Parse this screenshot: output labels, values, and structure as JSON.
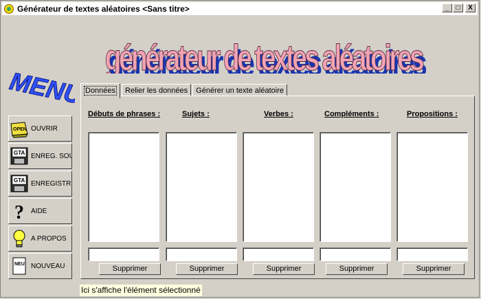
{
  "window": {
    "title": "Générateur de textes aléatoires  <Sans titre>",
    "controls": {
      "minimize": "_",
      "maximize": "□",
      "close": "X"
    }
  },
  "banner": {
    "text": "générateur de textes aléatoires"
  },
  "menu_logo": {
    "text": "MENU"
  },
  "sidebar": {
    "items": [
      {
        "label": "OUVRIR",
        "icon": "open-folder-icon",
        "icon_text": "OPEN"
      },
      {
        "label": "ENREG. SOUS",
        "icon": "save-as-disk-icon",
        "icon_text": "GTA"
      },
      {
        "label": "ENREGISTRER",
        "icon": "save-disk-icon",
        "icon_text": "GTA"
      },
      {
        "label": "AIDE",
        "icon": "question-mark-icon",
        "icon_text": "?"
      },
      {
        "label": "A PROPOS",
        "icon": "lightbulb-icon"
      },
      {
        "label": "NOUVEAU",
        "icon": "new-document-icon",
        "icon_text": "NEU"
      }
    ]
  },
  "tabs": [
    {
      "label": "Données",
      "active": true
    },
    {
      "label": "Relier les données",
      "active": false
    },
    {
      "label": "Générer un texte aléatoire",
      "active": false
    }
  ],
  "columns": [
    {
      "header": "Débuts de phrases :",
      "delete_label": "Supprimer"
    },
    {
      "header": "Sujets :",
      "delete_label": "Supprimer"
    },
    {
      "header": "Verbes :",
      "delete_label": "Supprimer"
    },
    {
      "header": "Compléments :",
      "delete_label": "Supprimer"
    },
    {
      "header": "Propositions :",
      "delete_label": "Supprimer"
    }
  ],
  "status": {
    "text": "Ici s'affiche l'élément sélectionné"
  },
  "colors": {
    "face": "#d4d0c8",
    "banner_fill": "#f0a0b0",
    "banner_side": "#2040c0",
    "status_bg": "#ffffe0"
  }
}
